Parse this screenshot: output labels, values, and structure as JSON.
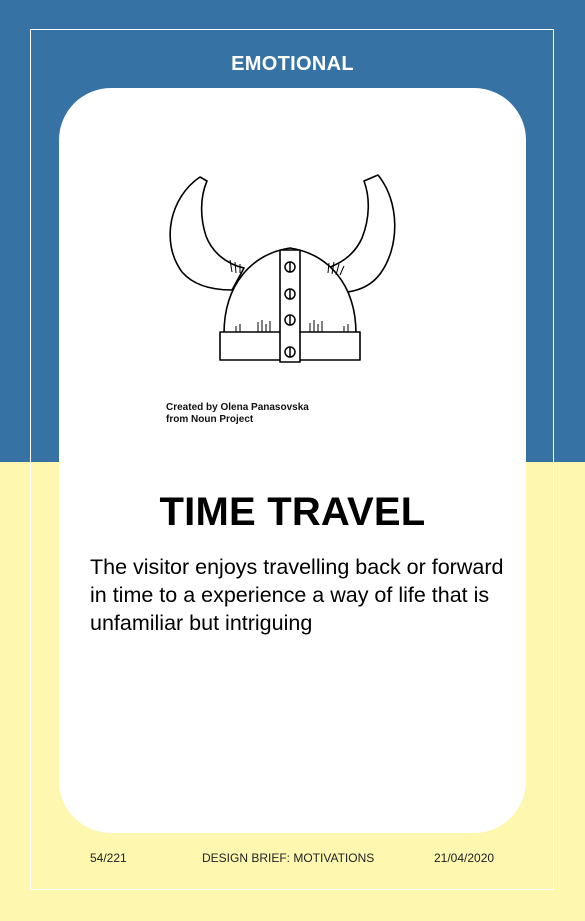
{
  "category": "EMOTIONAL",
  "illustration": {
    "icon": "viking-helmet-icon",
    "credit_line1": "Created by Olena Panasovska",
    "credit_line2": "from Noun Project"
  },
  "title": "TIME TRAVEL",
  "description": "The visitor enjoys travelling back or forward in time to a experience a way of life that is unfamiliar but intriguing",
  "footer": {
    "page": "54/221",
    "document": "DESIGN BRIEF: MOTIVATIONS",
    "date": "21/04/2020"
  },
  "colors": {
    "top_band": "#3672a3",
    "bottom_band": "#fdf7b0",
    "card": "#ffffff"
  }
}
